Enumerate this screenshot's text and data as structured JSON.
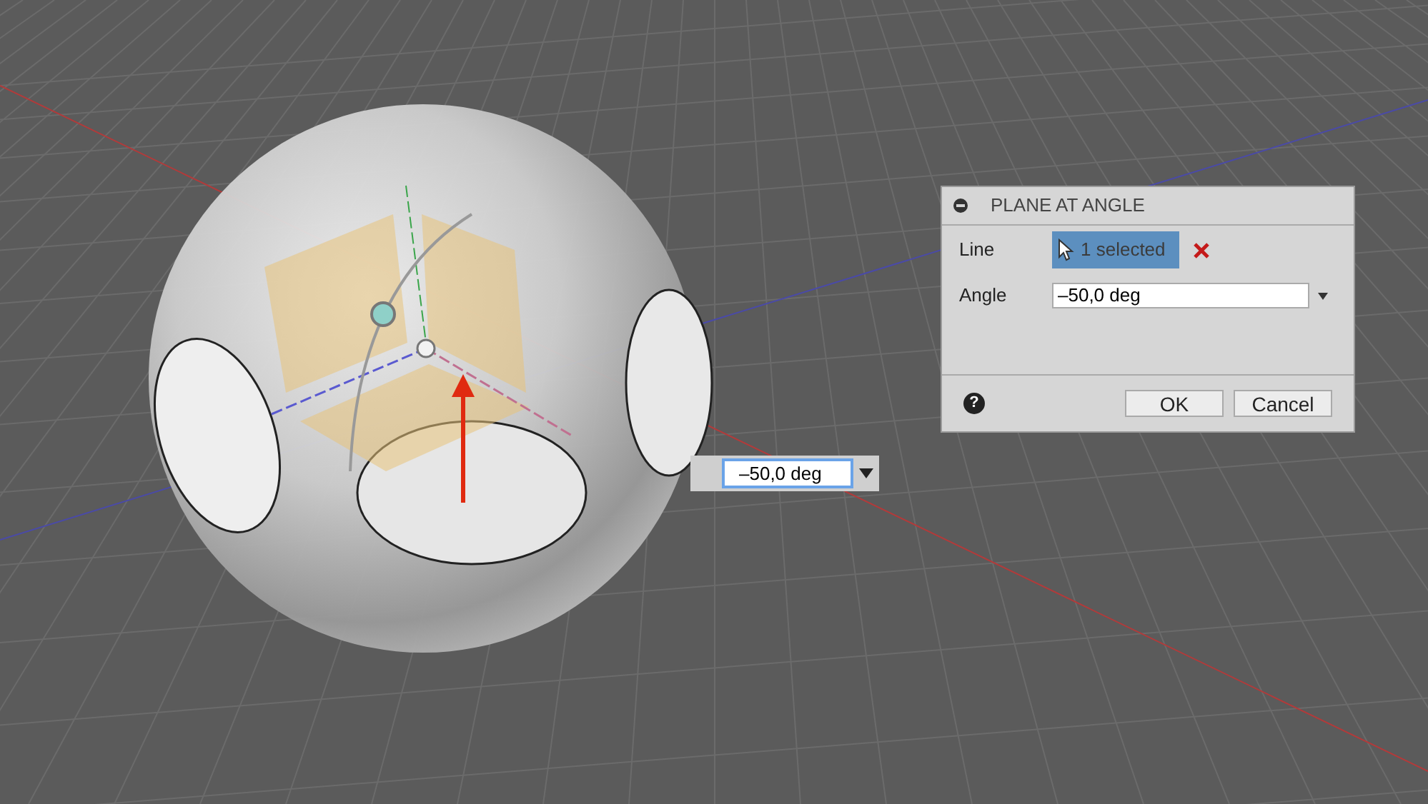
{
  "dialog": {
    "title": "PLANE AT ANGLE",
    "rows": [
      {
        "kind": "selection",
        "label": "Line",
        "value": "1 selected"
      },
      {
        "kind": "input",
        "label": "Angle",
        "value": "–50,0 deg"
      }
    ],
    "help": "?",
    "buttons": [
      "OK",
      "Cancel"
    ]
  },
  "canvas_input": {
    "value": "–50,0 deg"
  }
}
